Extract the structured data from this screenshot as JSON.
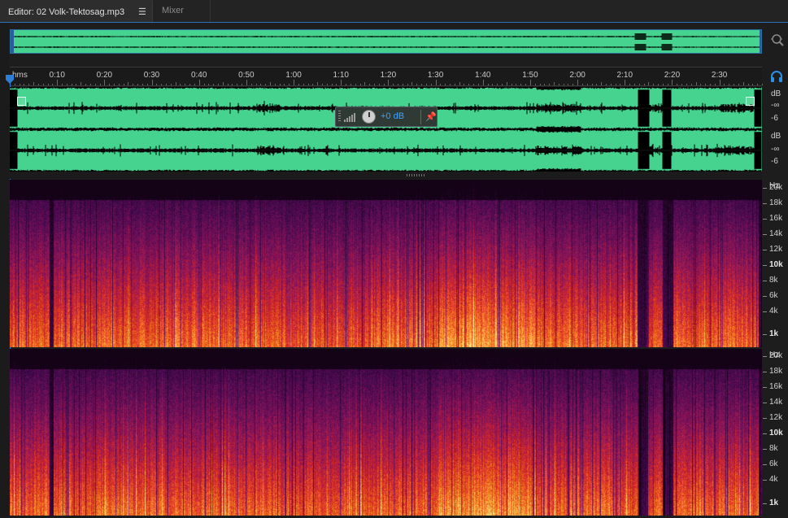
{
  "tabs": {
    "editor_label": "Editor: 02 Volk-Tektosag.mp3",
    "editor_menu": "☰",
    "mixer_label": "Mixer"
  },
  "ruler": {
    "unit_label": "hms",
    "ticks": [
      "0:10",
      "0:20",
      "0:30",
      "0:40",
      "0:50",
      "1:00",
      "1:10",
      "1:20",
      "1:30",
      "1:40",
      "1:50",
      "2:00",
      "2:10",
      "2:20",
      "2:30"
    ],
    "tick_seconds": [
      10,
      20,
      30,
      40,
      50,
      60,
      70,
      80,
      90,
      100,
      110,
      120,
      130,
      140,
      150
    ],
    "duration_seconds": 159
  },
  "hud": {
    "volume_value": "+0 dB"
  },
  "db_scale": {
    "unit": "dB",
    "neg_inf": "-∞",
    "minus6": "-6"
  },
  "spectral": {
    "unit": "Hz",
    "labels": [
      "20k",
      "18k",
      "16k",
      "14k",
      "12k",
      "10k",
      "8k",
      "6k",
      "4k",
      "1k"
    ],
    "label_khz": [
      20,
      18,
      16,
      14,
      12,
      10,
      8,
      6,
      4,
      1
    ],
    "bold_labels": [
      "10k",
      "1k"
    ]
  },
  "colors": {
    "waveform_bg": "#45d38f",
    "accent": "#2c7fd4",
    "hud_value": "#3aa3ff"
  },
  "icons": {
    "zoom": "zoom-icon",
    "headphones": "headphones-icon",
    "pin": "pin-icon",
    "menu": "menu-icon"
  }
}
